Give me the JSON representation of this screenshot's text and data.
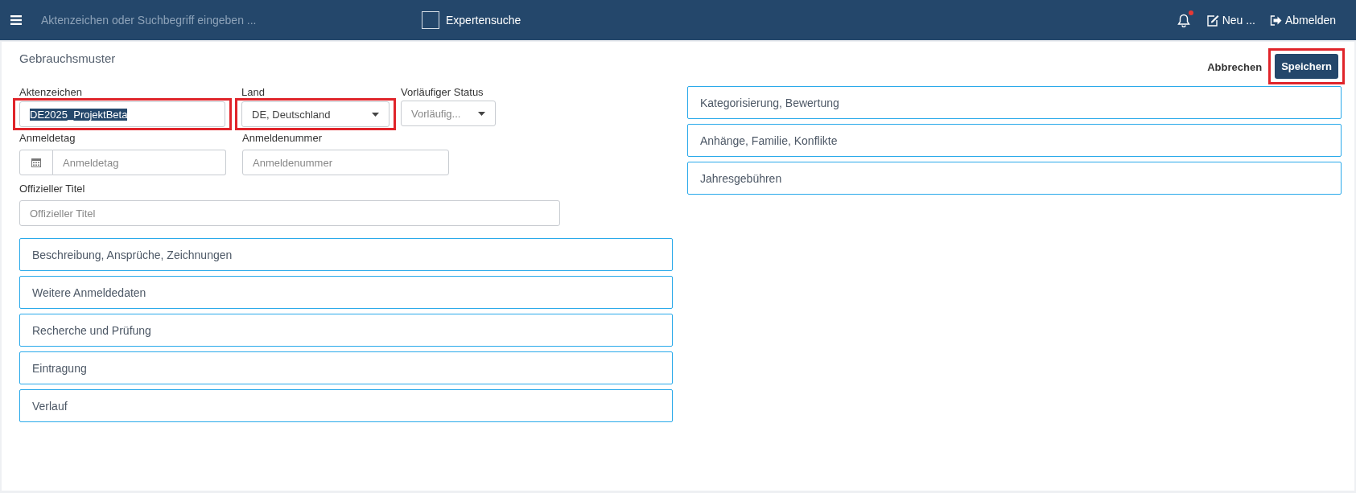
{
  "topbar": {
    "search": {
      "placeholder": "Aktenzeichen oder Suchbegriff eingeben ..."
    },
    "expert_search": {
      "label": "Expertensuche",
      "checked": false
    },
    "notifications": {
      "unread": true
    },
    "actions": [
      {
        "label": "Neu ...",
        "kind": "new"
      },
      {
        "label": "Abmelden",
        "kind": "logout"
      }
    ]
  },
  "form": {
    "title": "Gebrauchsmuster",
    "buttons": [
      {
        "label": "Abbrechen",
        "kind": "link",
        "highlighted": false
      },
      {
        "label": "Speichern",
        "kind": "primary",
        "highlighted": true
      }
    ],
    "field_rows": [
      [
        {
          "kind": "text",
          "label": "Aktenzeichen",
          "value": "DE2025_ProjektBeta",
          "value_selected": true,
          "highlighted": true
        },
        {
          "kind": "select",
          "label": "Land",
          "value": "DE, Deutschland",
          "highlighted": true
        },
        {
          "kind": "select",
          "label": "Vorläufiger Status",
          "placeholder": "Vorläufig...",
          "highlighted": false
        }
      ],
      [
        {
          "kind": "date",
          "label": "Anmeldetag",
          "placeholder": "Anmeldetag",
          "highlighted": false
        },
        {
          "kind": "text",
          "label": "Anmeldenummer",
          "placeholder": "Anmeldenummer",
          "highlighted": false
        }
      ],
      [
        {
          "kind": "text",
          "label": "Offizieller Titel",
          "placeholder": "Offizieller Titel",
          "highlighted": false
        }
      ]
    ],
    "left_sections": [
      "Beschreibung, Ansprüche, Zeichnungen",
      "Weitere Anmeldedaten",
      "Recherche und Prüfung",
      "Eintragung",
      "Verlauf"
    ],
    "right_sections": [
      "Kategorisierung, Bewertung",
      "Anhänge, Familie, Konflikte",
      "Jahresgebühren"
    ]
  }
}
